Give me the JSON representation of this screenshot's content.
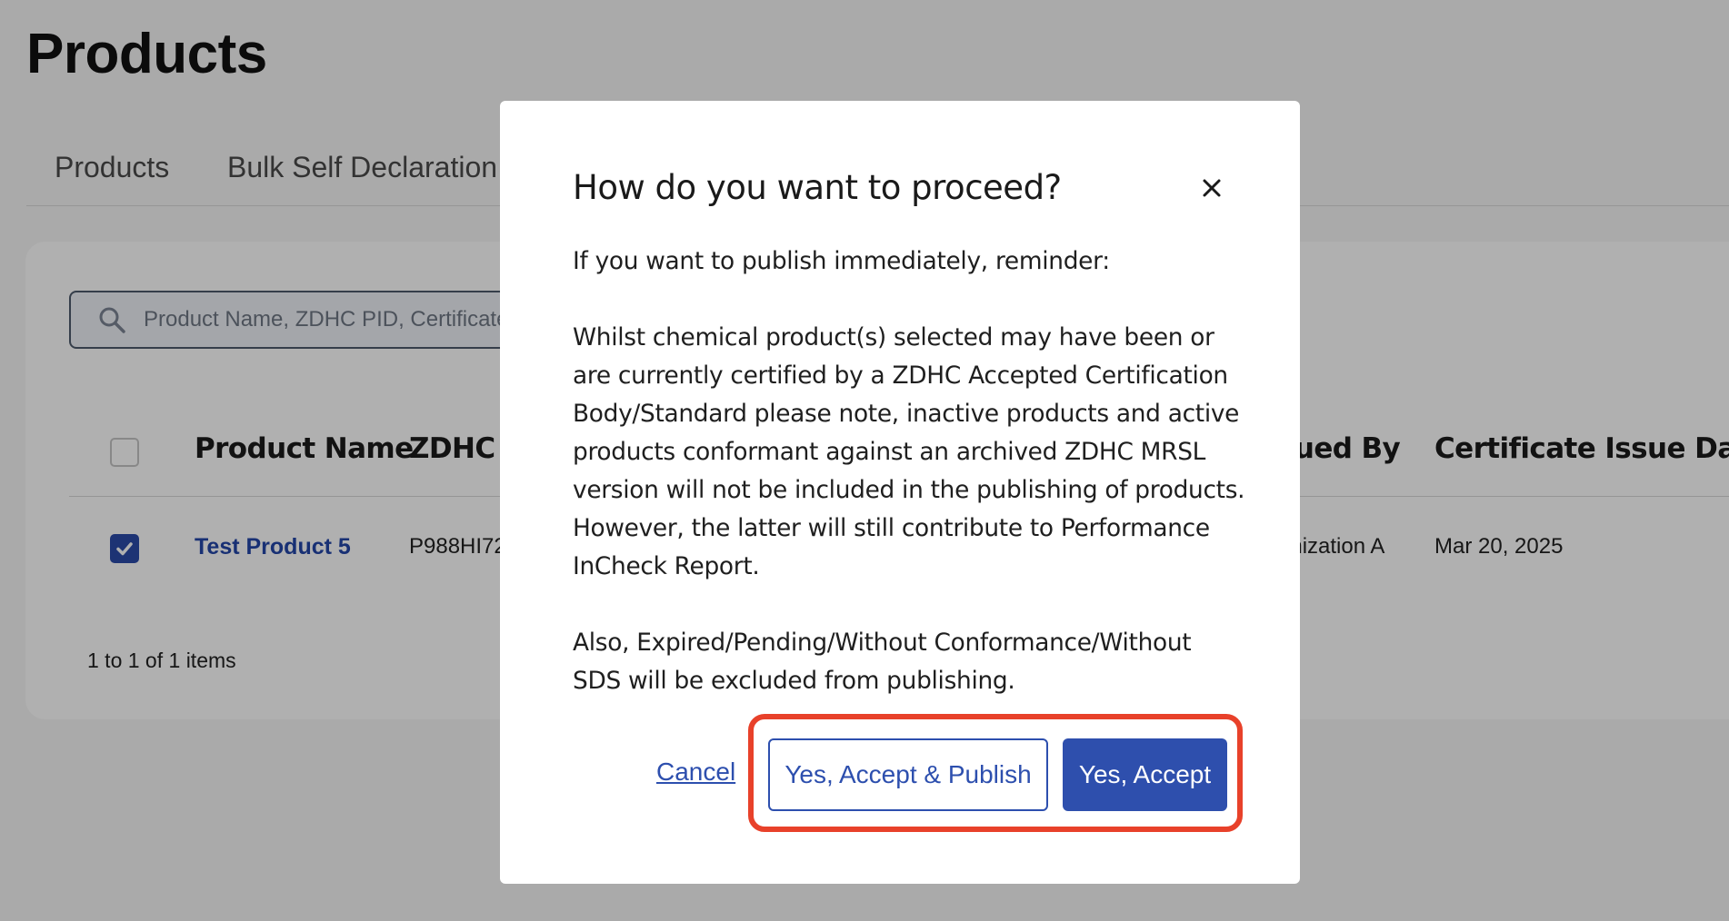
{
  "page": {
    "title": "Products",
    "tabs": [
      {
        "label": "Products"
      },
      {
        "label": "Bulk Self Declaration"
      }
    ],
    "search": {
      "placeholder": "Product Name, ZDHC PID, Certificate"
    },
    "table": {
      "headers": [
        "Product Name",
        "ZDHC F",
        "sued By",
        "Certificate Issue Date"
      ],
      "rows": [
        {
          "product_name": "Test Product 5",
          "pid": "P988HI72",
          "issued_by": "anization A",
          "issue_date": "Mar 20, 2025",
          "checked": true
        }
      ]
    },
    "pagination": "1 to 1 of 1 items"
  },
  "modal": {
    "title": "How do you want to proceed?",
    "paragraphs": [
      "If you want to publish immediately, reminder:",
      "Whilst chemical product(s) selected may have been or are currently certified by a ZDHC Accepted Certification Body/Standard please note, inactive products and active products conformant against an archived ZDHC MRSL version will not be included in the publishing of products. However, the latter will still contribute to Performance InCheck Report.",
      "Also, Expired/Pending/Without Conformance/Without SDS will be excluded from publishing."
    ],
    "cancel_label": "Cancel",
    "accept_publish_label": "Yes, Accept & Publish",
    "accept_label": "Yes, Accept"
  },
  "colors": {
    "primary": "#2e4fad",
    "highlight": "#e8412a",
    "overlay": "rgba(0,0,0,0.31)"
  },
  "icons": {
    "search": "search-icon",
    "close": "close-icon",
    "checkbox_checked": "checkmark-icon"
  }
}
